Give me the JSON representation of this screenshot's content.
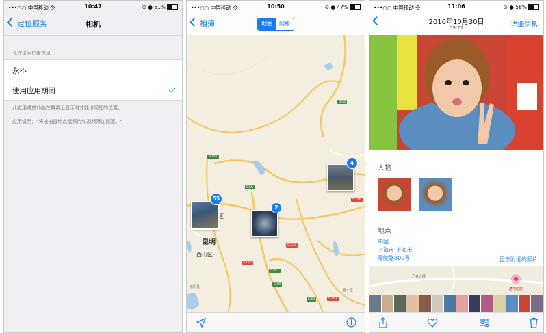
{
  "panel1": {
    "status": {
      "carrier": "•••○○ 中国移动 令",
      "time": "10:47",
      "right": "⊙ ● 51%",
      "battery": 0.51
    },
    "nav": {
      "back": "定位服务",
      "title": "相机"
    },
    "section_header": "允许访问位置信息",
    "options": [
      {
        "label": "永不",
        "selected": false
      },
      {
        "label": "使用应用期间",
        "selected": true
      }
    ],
    "footer1": "此应用或其功能在屏幕上显示时才能访问您的位置。",
    "footer2": "应用说明：\"将按拍摄地点组照片和视频添加标签。\""
  },
  "panel2": {
    "status": {
      "carrier": "•••○○ 中国移动 令",
      "time": "10:50",
      "right": "⊙ ● 47%",
      "battery": 0.47
    },
    "nav": {
      "back": "相簿"
    },
    "segments": [
      "地图",
      "网格"
    ],
    "active_segment": "地图",
    "clusters": [
      {
        "count": "55"
      },
      {
        "count": "2"
      },
      {
        "count": "4"
      }
    ],
    "labels": {
      "city": "昆明",
      "district": "西山区",
      "partial": "区",
      "small1": "嵩明县",
      "small2": "富民县",
      "small3": "晋宁区"
    },
    "highways": [
      "S001",
      "G56",
      "G56",
      "G85",
      "S101",
      "G78",
      "G80",
      "G56",
      "S320",
      "G320",
      "S320",
      "S201"
    ]
  },
  "panel3": {
    "status": {
      "carrier": "•••○○ 中国移动 令",
      "time": "11:06",
      "right": "⊙ ● 58%",
      "battery": 0.58
    },
    "nav": {
      "date": "2016年10月30日",
      "time": "09:27",
      "detail": "详细信息"
    },
    "people_title": "人物",
    "place_title": "地点",
    "location": [
      "中国",
      "上海市 上海市",
      "零陵路800号"
    ],
    "nearby": "显示附近的照片",
    "map_labels": {
      "a": "汇金大厦",
      "b": "漕中医院"
    },
    "accent_color": "#1a7cf5"
  }
}
